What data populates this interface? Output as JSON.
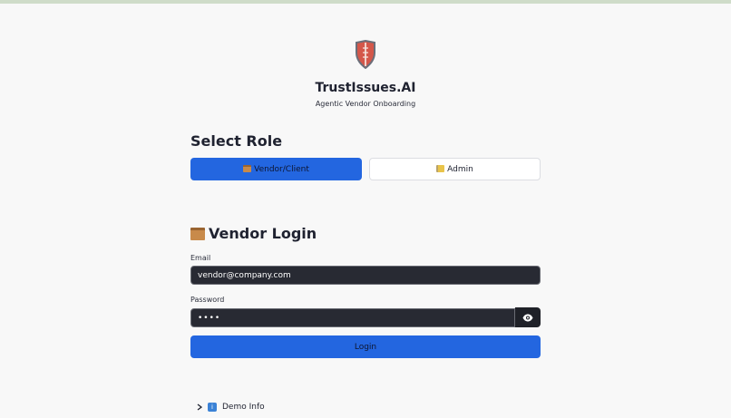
{
  "app": {
    "title": "TrustIssues.AI",
    "subtitle": "Agentic Vendor Onboarding",
    "logo_icon": "shield-icon"
  },
  "role_section": {
    "title": "Select Role",
    "options": [
      {
        "label": "Vendor/Client",
        "icon": "package-icon",
        "selected": true
      },
      {
        "label": "Admin",
        "icon": "lock-key-icon",
        "selected": false
      }
    ]
  },
  "login": {
    "heading": "Vendor Login",
    "heading_icon": "package-icon",
    "email_label": "Email",
    "email_value": "vendor@company.com",
    "password_label": "Password",
    "password_value": "••••",
    "show_password_icon": "eye-icon",
    "submit_label": "Login"
  },
  "demo": {
    "label": "Demo Info",
    "icon": "info-icon",
    "expanded": false
  },
  "colors": {
    "primary": "#2366e0",
    "background": "#f8f8f8",
    "input_bg": "#282a33",
    "top_bar": "#cfdcc9"
  }
}
